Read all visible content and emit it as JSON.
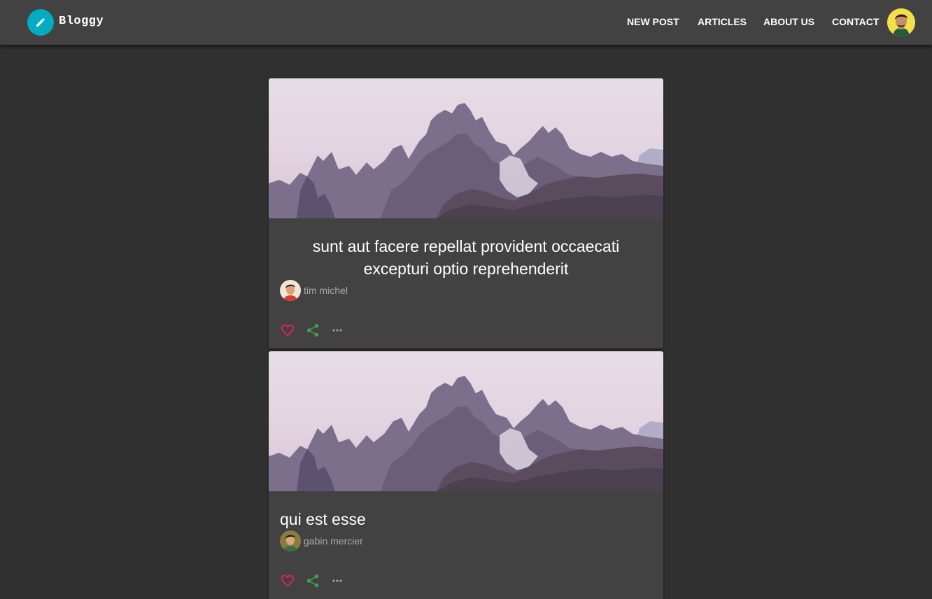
{
  "app": {
    "brand": "Bloggy"
  },
  "icons": {
    "logo": "pencil-icon",
    "like": "heart-outline-icon",
    "share": "share-icon",
    "more": "more-horizontal-icon"
  },
  "colors": {
    "logo_bg": "#00acc1",
    "like": "#e91e63",
    "share": "#43a047",
    "appbar": "#424242",
    "background": "#303030",
    "card": "#424242"
  },
  "nav": {
    "items": [
      {
        "label": "NEW POST"
      },
      {
        "label": "ARTICLES"
      },
      {
        "label": "ABOUT US"
      },
      {
        "label": "CONTACT"
      }
    ]
  },
  "posts": [
    {
      "title_line1": "sunt aut facere repellat provident occaecati",
      "title_line2": "excepturi optio reprehenderit",
      "author": "tim michel"
    },
    {
      "title_line1": "qui est esse",
      "author": "gabin mercier"
    }
  ]
}
